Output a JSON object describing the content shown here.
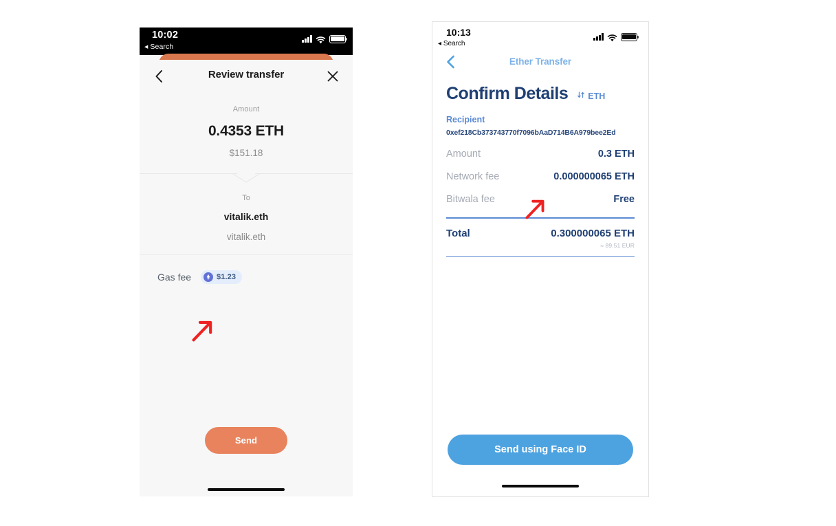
{
  "colors": {
    "orange_accent": "#e8835d",
    "orange_card": "#d9784e",
    "blue_accent": "#4da2e0",
    "navy": "#1f3f73",
    "link_blue": "#5b8ad4",
    "badge_bg": "#e4edfb",
    "eth_chip": "#6271d6",
    "annotation_red": "#ee2222"
  },
  "phone_a": {
    "status_bar": {
      "time": "10:02",
      "back_app": "Search",
      "icons": [
        "cellular-signal-icon",
        "wifi-icon",
        "battery-icon"
      ]
    },
    "nav": {
      "back_icon": "chevron-left-icon",
      "title": "Review transfer",
      "close_icon": "close-icon"
    },
    "amount": {
      "label": "Amount",
      "value": "0.4353 ETH",
      "fiat": "$151.18"
    },
    "recipient": {
      "label": "To",
      "name": "vitalik.eth",
      "sub": "vitalik.eth"
    },
    "gas": {
      "label": "Gas fee",
      "badge_icon": "ethereum-icon",
      "badge_value": "$1.23"
    },
    "primary_button": "Send"
  },
  "phone_b": {
    "status_bar": {
      "time": "10:13",
      "back_app": "Search",
      "icons": [
        "cellular-signal-icon",
        "wifi-icon",
        "battery-icon"
      ]
    },
    "nav": {
      "back_icon": "chevron-left-icon",
      "title": "Ether Transfer"
    },
    "page_title": "Confirm Details",
    "currency_toggle": {
      "icon": "sort-arrows-icon",
      "label": "ETH"
    },
    "recipient": {
      "label": "Recipient",
      "address": "0xef218Cb373743770f7096bAaD714B6A979bee2Ed"
    },
    "rows": [
      {
        "key": "Amount",
        "value": "0.3 ETH"
      },
      {
        "key": "Network fee",
        "value": "0.000000065 ETH"
      },
      {
        "key": "Bitwala fee",
        "value": "Free"
      }
    ],
    "total": {
      "key": "Total",
      "value": "0.300000065 ETH",
      "sub": "≈ 89.51 EUR"
    },
    "primary_button": "Send using Face ID"
  },
  "annotations": [
    {
      "name": "arrow-gas-fee",
      "points_to": "gas fee badge",
      "direction": "up-right"
    },
    {
      "name": "arrow-network-fee",
      "points_to": "network fee value",
      "direction": "up-right"
    }
  ]
}
